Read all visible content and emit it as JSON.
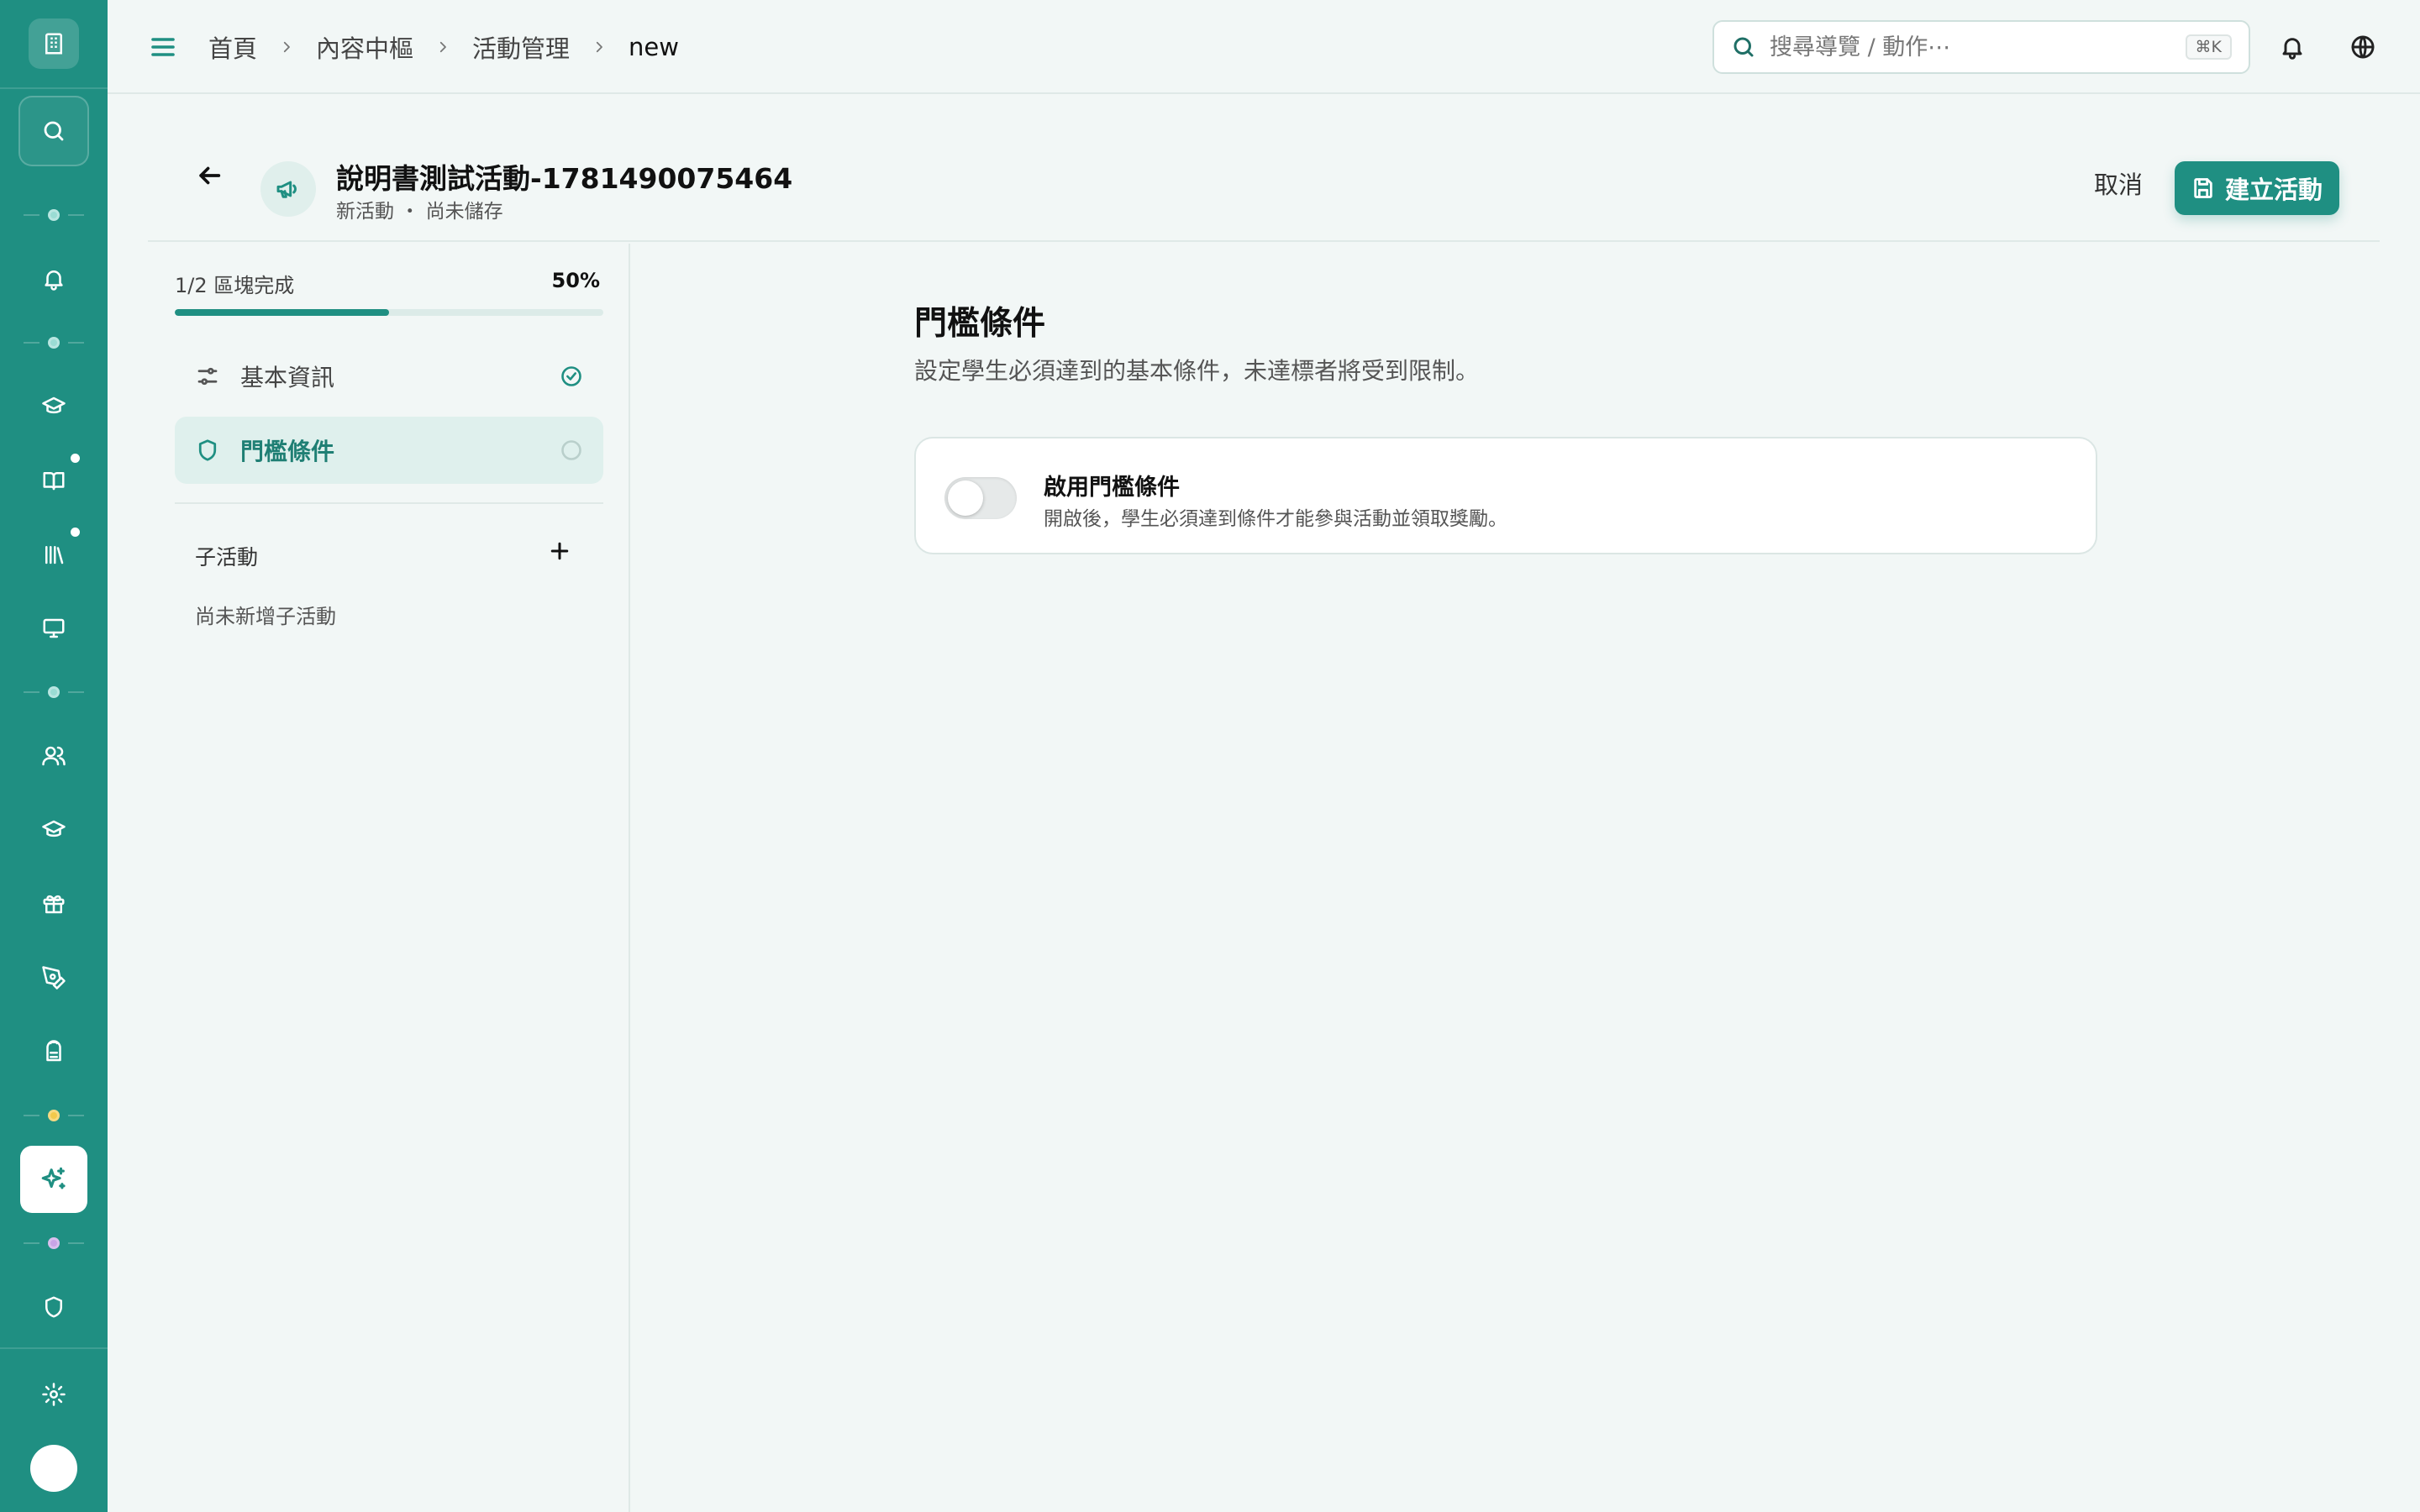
{
  "rail": {
    "items": [
      "building-icon",
      "search-icon",
      "bell-icon",
      "graduation-cap-icon",
      "book-open-icon",
      "library-icon",
      "monitor-icon",
      "users-icon",
      "graduation-cap-icon",
      "gift-icon",
      "pen-tool-icon",
      "backpack-icon",
      "sparkles-icon",
      "shield-icon",
      "gear-icon"
    ],
    "active_item": "sparkles-icon",
    "separator_colors": [
      "#9adcd4",
      "#9adcd4",
      "#9adcd4",
      "#f2c94c",
      "#c9a4e6"
    ]
  },
  "topbar": {
    "breadcrumb": [
      "首頁",
      "內容中樞",
      "活動管理",
      "new"
    ],
    "search_placeholder": "搜尋導覽 / 動作⋯",
    "search_shortcut": "⌘K"
  },
  "header": {
    "title": "說明書測試活動-1781490075464",
    "subtitle": "新活動 ・ 尚未儲存",
    "cancel_label": "取消",
    "create_label": "建立活動"
  },
  "progress": {
    "label": "1/2 區塊完成",
    "percent_label": "50%",
    "fraction": 0.5
  },
  "sections": [
    {
      "label": "基本資訊",
      "icon": "sliders-icon",
      "status": "complete"
    },
    {
      "label": "門檻條件",
      "icon": "shield-icon",
      "status": "incomplete"
    }
  ],
  "sub_activities": {
    "title": "子活動",
    "empty_text": "尚未新增子活動"
  },
  "main": {
    "title": "門檻條件",
    "description": "設定學生必須達到的基本條件，未達標者將受到限制。",
    "toggle": {
      "label": "啟用門檻條件",
      "description": "開啟後，學生必須達到條件才能參與活動並領取獎勵。",
      "enabled": false
    }
  },
  "colors": {
    "accent": "#1f8f82",
    "rail_bg": "#1f8f82",
    "page_bg": "#f2f7f6"
  }
}
